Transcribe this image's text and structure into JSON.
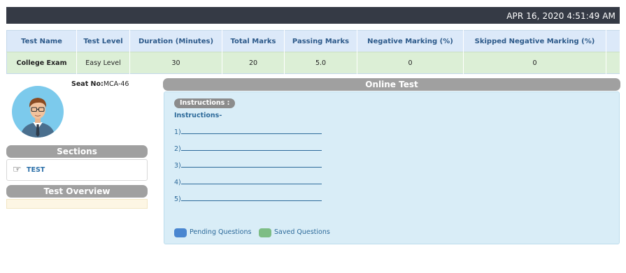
{
  "header": {
    "datetime": "APR 16, 2020  4:51:49 AM"
  },
  "exam_table": {
    "columns": [
      "Test Name",
      "Test Level",
      "Duration (Minutes)",
      "Total Marks",
      "Passing Marks",
      "Negative Marking (%)",
      "Skipped Negative Marking (%)"
    ],
    "row": [
      "College Exam",
      "Easy Level",
      "30",
      "20",
      "5.0",
      "0",
      "0"
    ]
  },
  "candidate": {
    "seat_label": "Seat No:",
    "seat_value": "MCA-46"
  },
  "sections": {
    "title": "Sections",
    "items": [
      {
        "label": "TEST"
      }
    ]
  },
  "overview": {
    "title": "Test Overview"
  },
  "online_test": {
    "title": "Online Test",
    "instructions_pill": "Instructions :",
    "instructions_heading": "Instructions-",
    "lines": [
      "1)",
      "2)",
      "3)",
      "4)",
      "5)"
    ],
    "legend": [
      {
        "label": "Pending Questions",
        "color": "#4a86d0"
      },
      {
        "label": "Saved Questions",
        "color": "#7dbd85"
      }
    ]
  },
  "colors": {
    "topbar": "#353a45",
    "header_row": "#dce9f9",
    "data_row": "#dcefd6",
    "panel": "#d9edf7",
    "accent_text": "#2d6a9a"
  }
}
